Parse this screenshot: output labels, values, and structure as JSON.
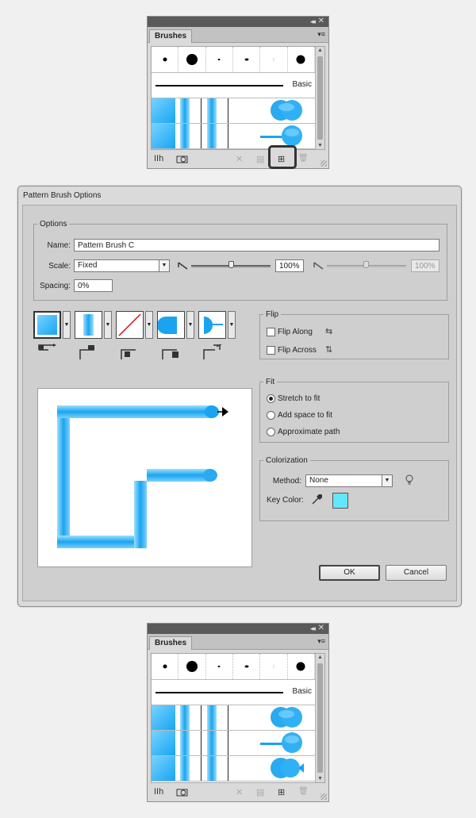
{
  "colors": {
    "accent_blue": "#1aa4ef",
    "key_color": "#63e7ff"
  },
  "panels": [
    {
      "id": "top",
      "tab": "Brushes",
      "basic_label": "Basic",
      "rows": 2
    },
    {
      "id": "bottom",
      "tab": "Brushes",
      "basic_label": "Basic",
      "rows": 3
    }
  ],
  "panel_icons": {
    "library": "IIh",
    "menu": "▾≡",
    "collapse": "◂◂",
    "close": "✕",
    "remove_stroke": "✕",
    "options": "▤",
    "new": "⊞",
    "delete": "🗑"
  },
  "dialog": {
    "title": "Pattern Brush Options",
    "options_group": "Options",
    "name_label": "Name:",
    "name_value": "Pattern Brush C",
    "scale_label": "Scale:",
    "scale_value": "Fixed",
    "scale_percent": "100%",
    "scale_percent2": "100%",
    "spacing_label": "Spacing:",
    "spacing_value": "0%",
    "flip_group": "Flip",
    "flip_along": "Flip Along",
    "flip_across": "Flip Across",
    "fit_group": "Fit",
    "fit_options": [
      "Stretch to fit",
      "Add space to fit",
      "Approximate path"
    ],
    "fit_selected": 0,
    "colorization_group": "Colorization",
    "method_label": "Method:",
    "method_value": "None",
    "key_color_label": "Key Color:",
    "ok_label": "OK",
    "cancel_label": "Cancel"
  }
}
